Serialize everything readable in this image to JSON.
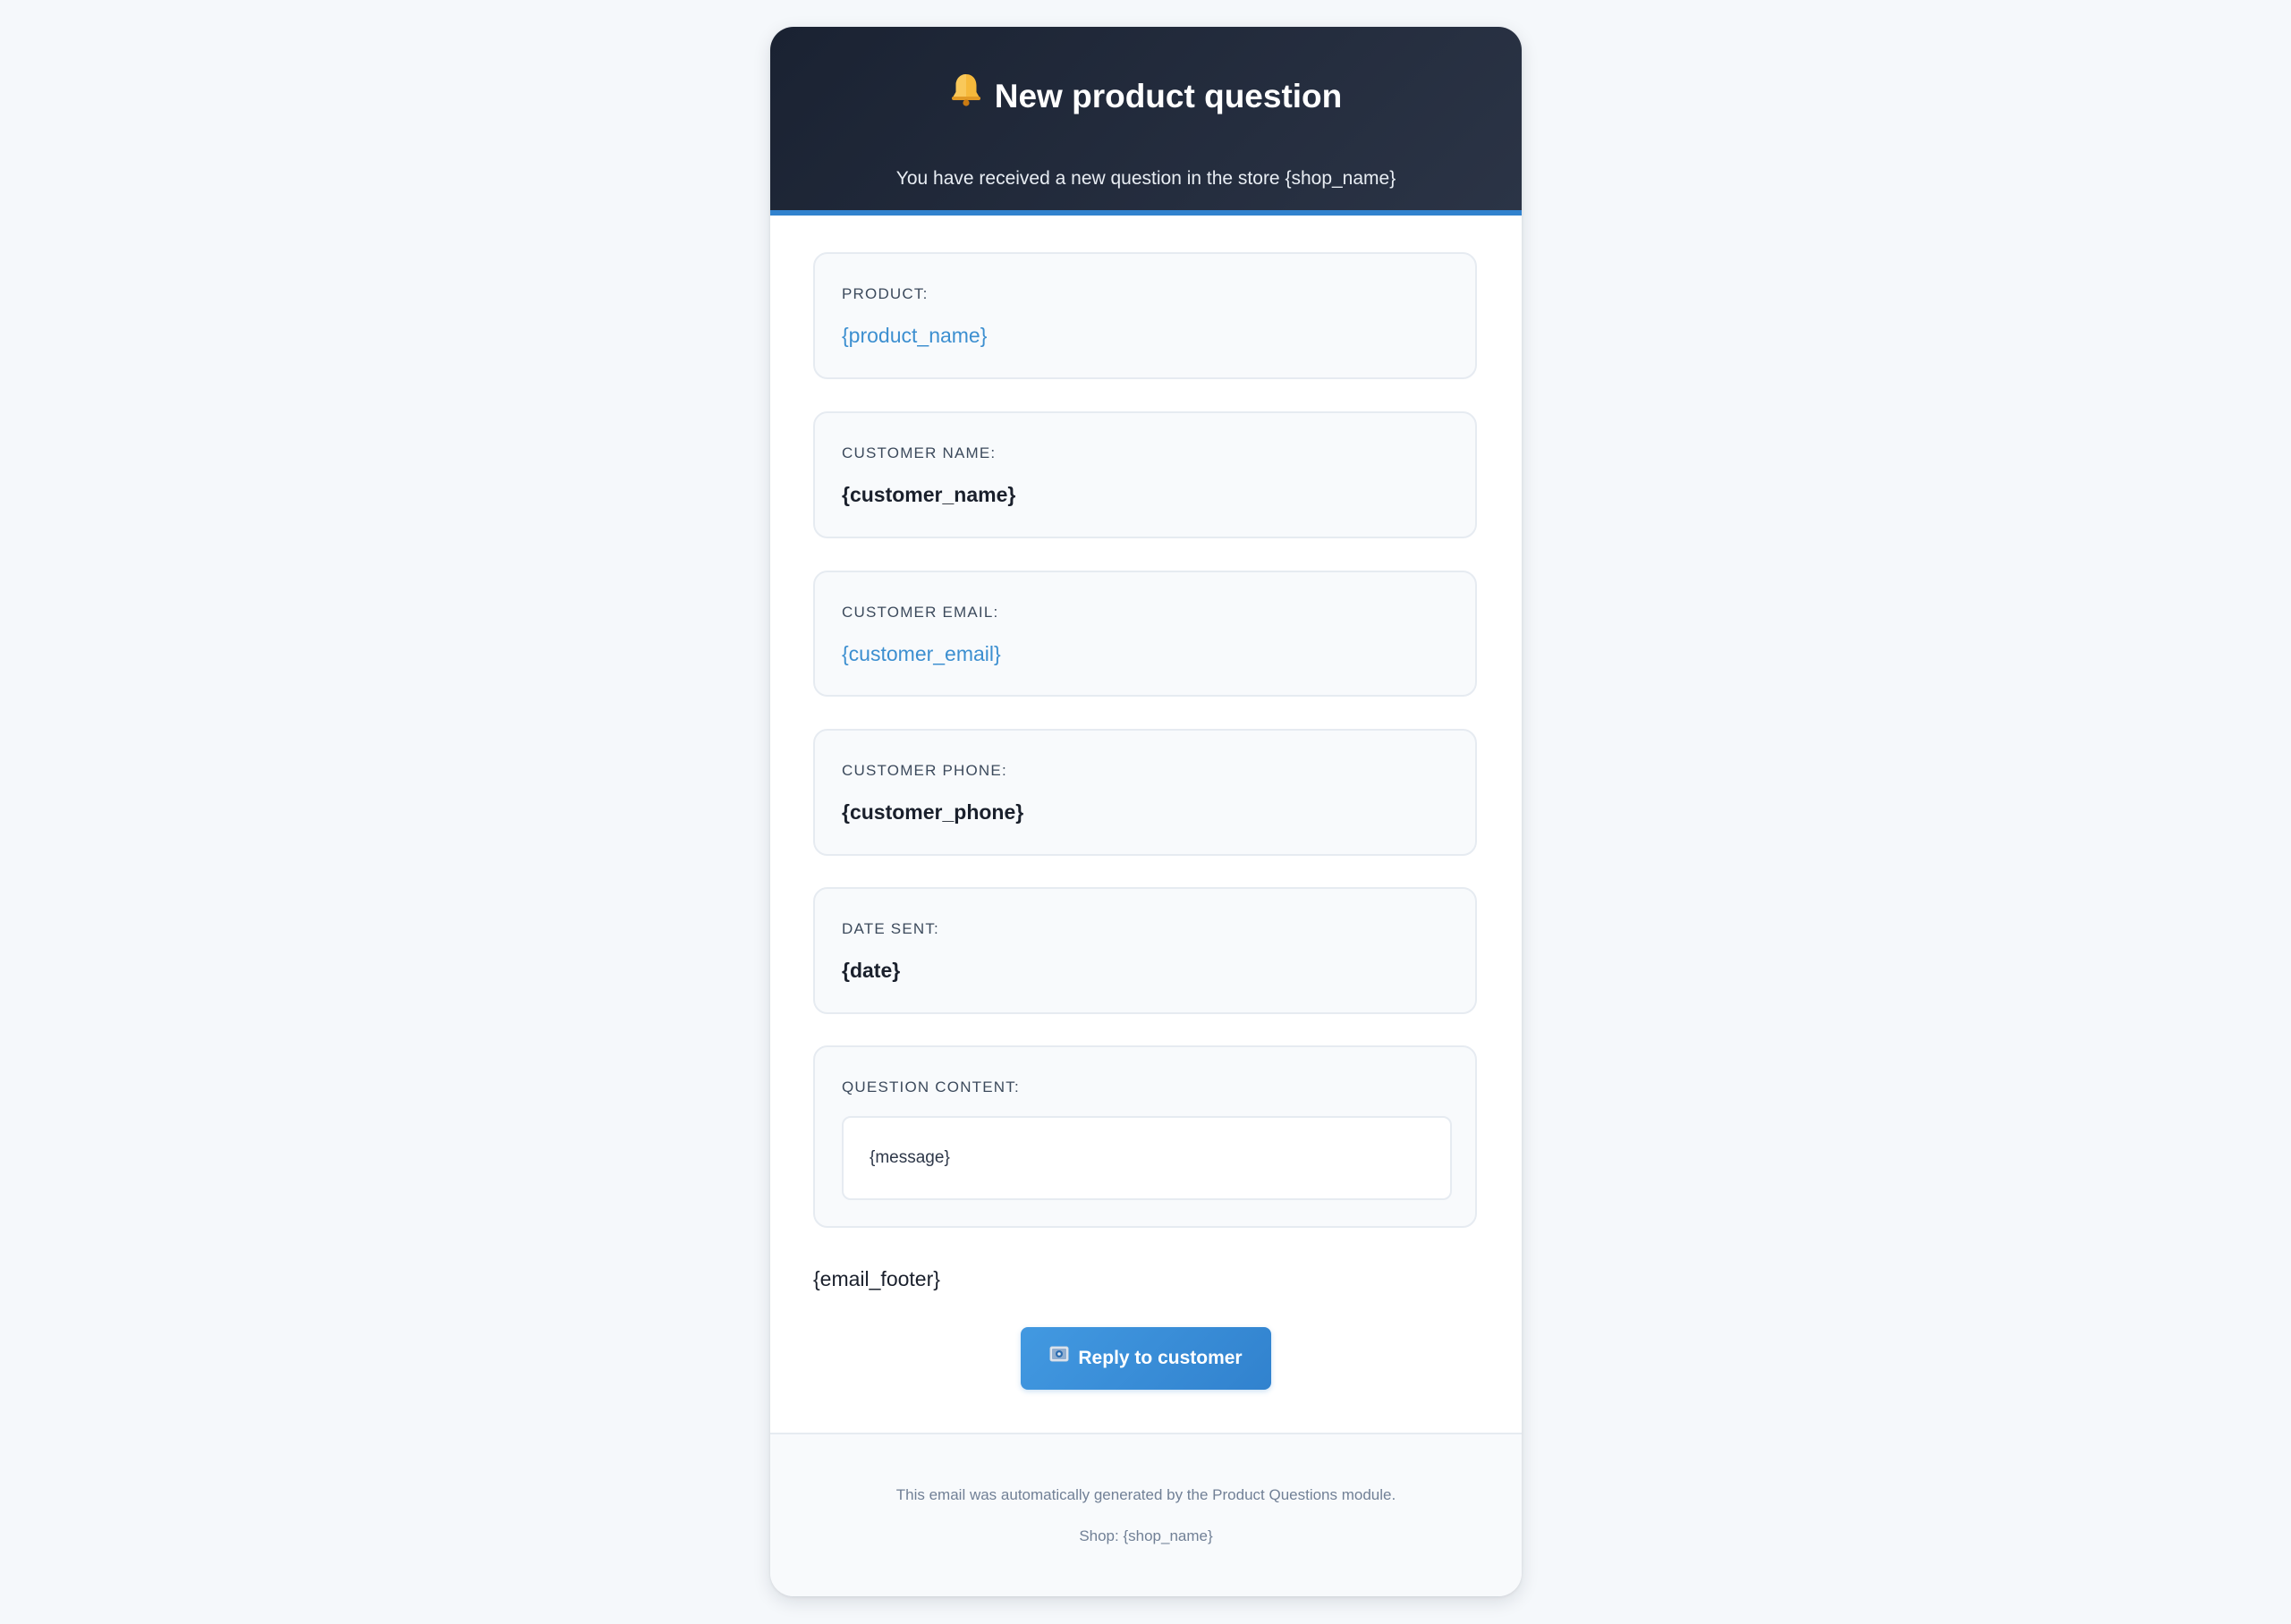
{
  "header": {
    "title": "New product question",
    "subtitle": "You have received a new question in the store {shop_name}"
  },
  "fields": {
    "product": {
      "label": "PRODUCT:",
      "value": "{product_name}"
    },
    "customer_name": {
      "label": "CUSTOMER NAME:",
      "value": "{customer_name}"
    },
    "customer_email": {
      "label": "CUSTOMER EMAIL:",
      "value": "{customer_email}"
    },
    "customer_phone": {
      "label": "CUSTOMER PHONE:",
      "value": "{customer_phone}"
    },
    "date_sent": {
      "label": "DATE SENT:",
      "value": "{date}"
    },
    "question_content": {
      "label": "QUESTION CONTENT:",
      "value": "{message}"
    }
  },
  "email_footer": "{email_footer}",
  "reply_button": {
    "label": "Reply to customer"
  },
  "footer": {
    "note": "This email was automatically generated by the Product Questions module.",
    "shop": "Shop: {shop_name}"
  },
  "icons": {
    "title_icon": "bell-icon",
    "button_icon": "envelope-icon"
  },
  "colors": {
    "header_background": "#1a2232",
    "header_accent": "#3182ce",
    "link": "#3c8fd0",
    "button": "#4299e1",
    "page_background": "#f5f8fb"
  }
}
